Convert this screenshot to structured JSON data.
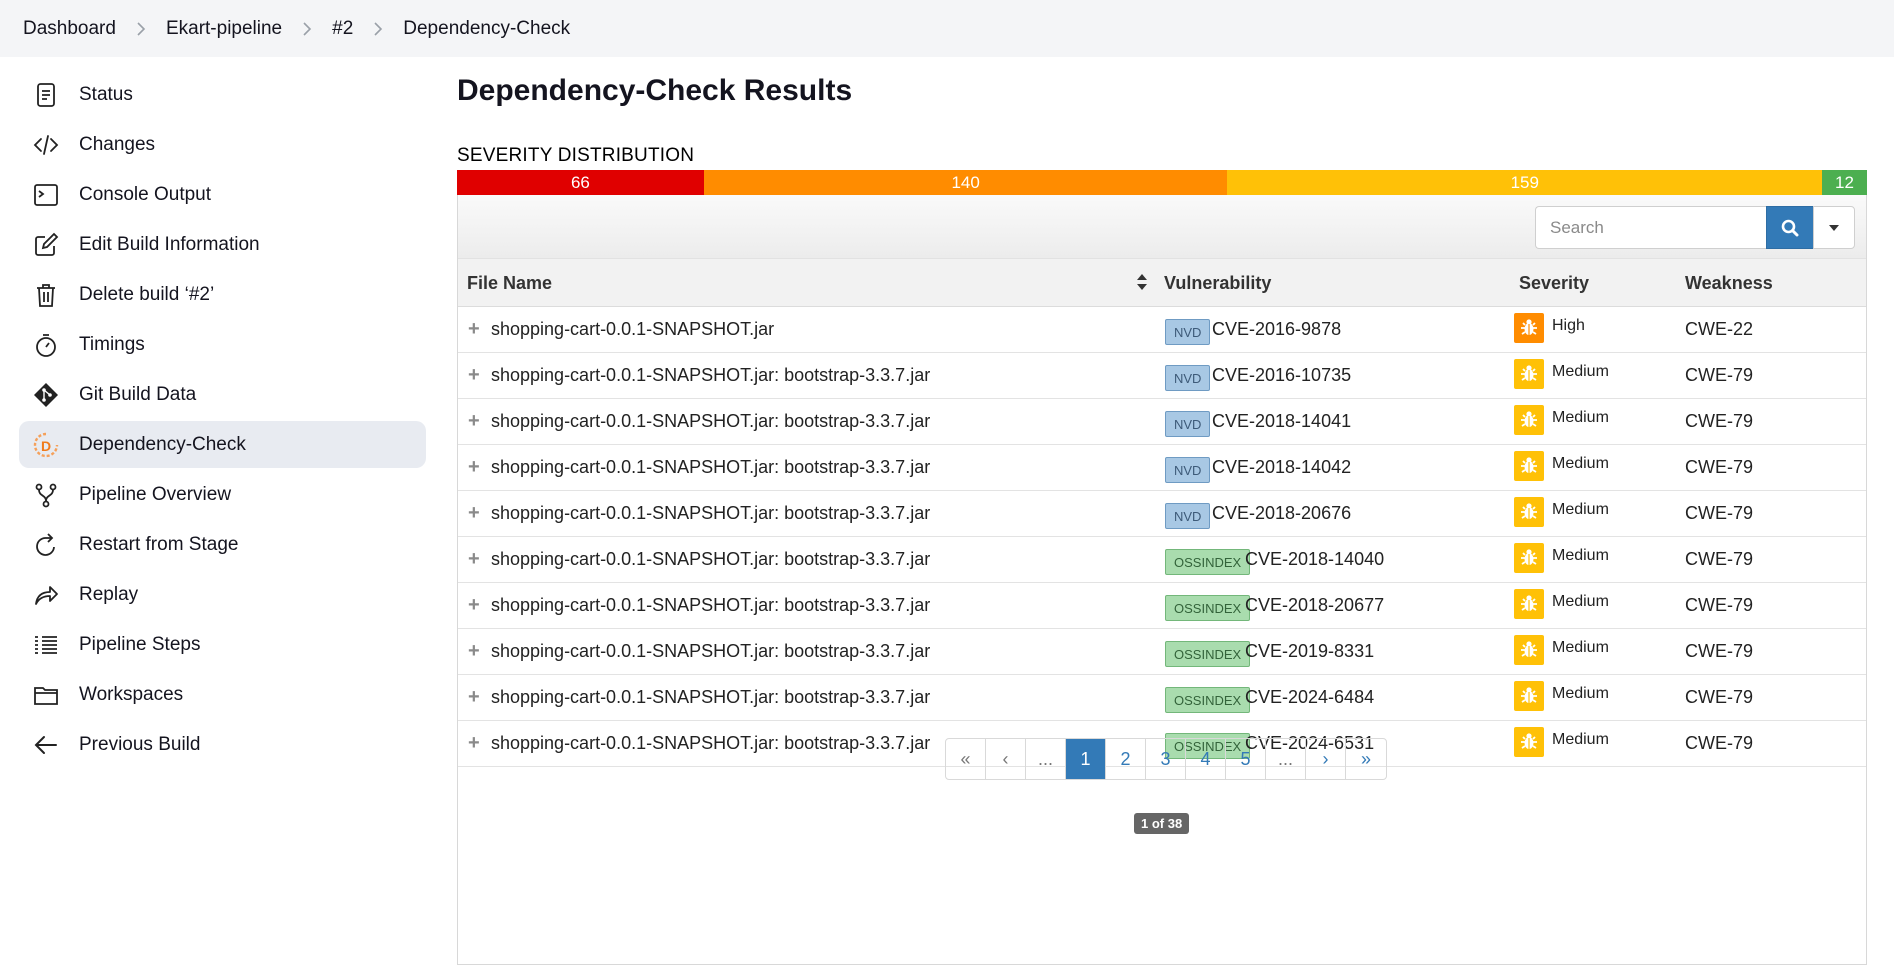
{
  "breadcrumb": [
    "Dashboard",
    "Ekart-pipeline",
    "#2",
    "Dependency-Check"
  ],
  "sidebar": {
    "items": [
      {
        "label": "Status",
        "icon": "status-icon"
      },
      {
        "label": "Changes",
        "icon": "code-icon"
      },
      {
        "label": "Console Output",
        "icon": "terminal-icon"
      },
      {
        "label": "Edit Build Information",
        "icon": "edit-icon"
      },
      {
        "label": "Delete build ‘#2’",
        "icon": "trash-icon"
      },
      {
        "label": "Timings",
        "icon": "stopwatch-icon"
      },
      {
        "label": "Git Build Data",
        "icon": "git-icon"
      },
      {
        "label": "Dependency-Check",
        "icon": "dependency-check-icon",
        "active": true
      },
      {
        "label": "Pipeline Overview",
        "icon": "branch-icon"
      },
      {
        "label": "Restart from Stage",
        "icon": "restart-icon"
      },
      {
        "label": "Replay",
        "icon": "replay-icon"
      },
      {
        "label": "Pipeline Steps",
        "icon": "list-icon"
      },
      {
        "label": "Workspaces",
        "icon": "folder-icon"
      },
      {
        "label": "Previous Build",
        "icon": "arrow-left-icon"
      }
    ]
  },
  "main": {
    "title": "Dependency-Check Results",
    "severity_title": "SEVERITY DISTRIBUTION",
    "severity": [
      {
        "count": "66",
        "value": 66,
        "color": "#e00000"
      },
      {
        "count": "140",
        "value": 140,
        "color": "#ff8c00"
      },
      {
        "count": "159",
        "value": 159,
        "color": "#ffc107"
      },
      {
        "count": "12",
        "value": 12,
        "color": "#4caf50"
      }
    ],
    "search_placeholder": "Search",
    "columns": {
      "file": "File Name",
      "vuln": "Vulnerability",
      "severity": "Severity",
      "weakness": "Weakness"
    },
    "rows": [
      {
        "file": "shopping-cart-0.0.1-SNAPSHOT.jar",
        "source": "NVD",
        "cve": "CVE-2016-9878",
        "severity": "High",
        "weakness": "CWE-22"
      },
      {
        "file": "shopping-cart-0.0.1-SNAPSHOT.jar: bootstrap-3.3.7.jar",
        "source": "NVD",
        "cve": "CVE-2016-10735",
        "severity": "Medium",
        "weakness": "CWE-79"
      },
      {
        "file": "shopping-cart-0.0.1-SNAPSHOT.jar: bootstrap-3.3.7.jar",
        "source": "NVD",
        "cve": "CVE-2018-14041",
        "severity": "Medium",
        "weakness": "CWE-79"
      },
      {
        "file": "shopping-cart-0.0.1-SNAPSHOT.jar: bootstrap-3.3.7.jar",
        "source": "NVD",
        "cve": "CVE-2018-14042",
        "severity": "Medium",
        "weakness": "CWE-79"
      },
      {
        "file": "shopping-cart-0.0.1-SNAPSHOT.jar: bootstrap-3.3.7.jar",
        "source": "NVD",
        "cve": "CVE-2018-20676",
        "severity": "Medium",
        "weakness": "CWE-79"
      },
      {
        "file": "shopping-cart-0.0.1-SNAPSHOT.jar: bootstrap-3.3.7.jar",
        "source": "OSSINDEX",
        "cve": "CVE-2018-14040",
        "severity": "Medium",
        "weakness": "CWE-79"
      },
      {
        "file": "shopping-cart-0.0.1-SNAPSHOT.jar: bootstrap-3.3.7.jar",
        "source": "OSSINDEX",
        "cve": "CVE-2018-20677",
        "severity": "Medium",
        "weakness": "CWE-79"
      },
      {
        "file": "shopping-cart-0.0.1-SNAPSHOT.jar: bootstrap-3.3.7.jar",
        "source": "OSSINDEX",
        "cve": "CVE-2019-8331",
        "severity": "Medium",
        "weakness": "CWE-79"
      },
      {
        "file": "shopping-cart-0.0.1-SNAPSHOT.jar: bootstrap-3.3.7.jar",
        "source": "OSSINDEX",
        "cve": "CVE-2024-6484",
        "severity": "Medium",
        "weakness": "CWE-79"
      },
      {
        "file": "shopping-cart-0.0.1-SNAPSHOT.jar: bootstrap-3.3.7.jar",
        "source": "OSSINDEX",
        "cve": "CVE-2024-6531",
        "severity": "Medium",
        "weakness": "CWE-79"
      }
    ],
    "severity_colors": {
      "High": "#ff8c00",
      "Medium": "#ffc107"
    },
    "pagination": [
      "«",
      "‹",
      "...",
      "1",
      "2",
      "3",
      "4",
      "5",
      "...",
      "›",
      "»"
    ],
    "current_page": "1",
    "page_info": "1 of 38"
  }
}
